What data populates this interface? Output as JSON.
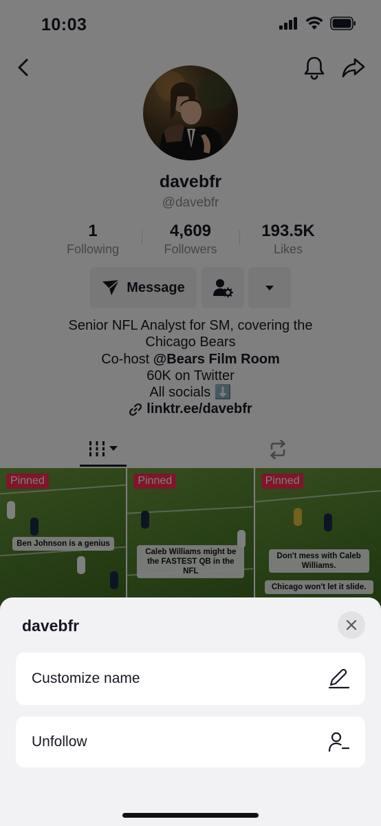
{
  "status_bar": {
    "time": "10:03"
  },
  "profile": {
    "display_name": "davebfr",
    "username": "@davebfr",
    "stats": [
      {
        "value": "1",
        "label": "Following"
      },
      {
        "value": "4,609",
        "label": "Followers"
      },
      {
        "value": "193.5K",
        "label": "Likes"
      }
    ],
    "message_label": "Message",
    "bio": {
      "line1": "Senior NFL Analyst for SM, covering the",
      "line2": "Chicago Bears",
      "line3_prefix": "Co-host ",
      "line3_mention": "@Bears Film Room",
      "line4": "60K on Twitter",
      "line5": "All socials ⬇️",
      "link": "linktr.ee/davebfr"
    }
  },
  "videos": [
    {
      "badge": "Pinned",
      "captions": [
        "Ben Johnson is a genius"
      ]
    },
    {
      "badge": "Pinned",
      "captions": [
        "Caleb Williams might be the FASTEST QB in the NFL"
      ]
    },
    {
      "badge": "Pinned",
      "captions": [
        "Don't mess with Caleb Williams.",
        "Chicago won't let it slide."
      ]
    }
  ],
  "sheet": {
    "title": "davebfr",
    "items": [
      {
        "label": "Customize name",
        "icon": "pencil-icon"
      },
      {
        "label": "Unfollow",
        "icon": "unfollow-user-icon"
      }
    ]
  },
  "colors": {
    "pinned_badge": "#fe2c55",
    "overlay": "rgba(0,0,0,0.5)",
    "sheet_bg": "#f2f2f4"
  }
}
